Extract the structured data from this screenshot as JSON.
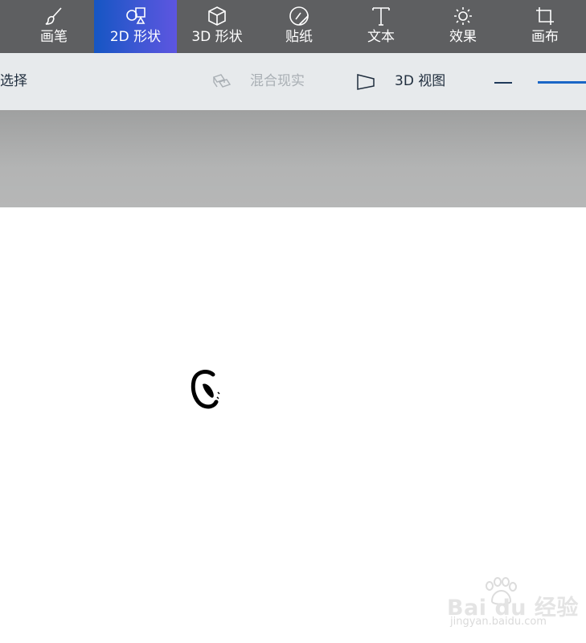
{
  "toolbar": {
    "tools": [
      {
        "label": "画笔",
        "icon": "brush-icon"
      },
      {
        "label": "2D 形状",
        "icon": "shapes-2d-icon",
        "active": true
      },
      {
        "label": "3D 形状",
        "icon": "cube-icon"
      },
      {
        "label": "贴纸",
        "icon": "sticker-icon"
      },
      {
        "label": "文本",
        "icon": "text-icon"
      },
      {
        "label": "效果",
        "icon": "sun-icon"
      },
      {
        "label": "画布",
        "icon": "crop-icon"
      }
    ],
    "active_color": "#2f57d0"
  },
  "subbar": {
    "select_label": "选择",
    "mixed_reality_label": "混合现实",
    "view3d_label": "3D 视图"
  },
  "watermark": {
    "main": "Bai du 经验",
    "sub": "jingyan.baidu.com"
  }
}
